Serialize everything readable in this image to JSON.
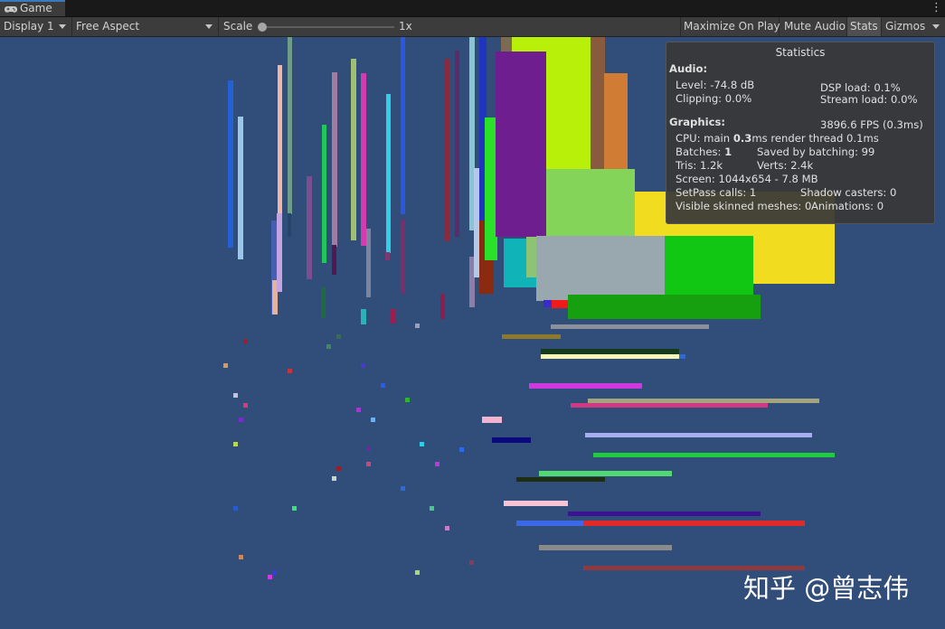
{
  "tab": {
    "title": "Game",
    "icon": "gamepad-icon"
  },
  "menu_icon": "kebab-menu-icon",
  "toolbar": {
    "display": "Display 1",
    "aspect": "Free Aspect",
    "scale_label": "Scale",
    "scale_value": "1x",
    "maximize": "Maximize On Play",
    "mute": "Mute Audio",
    "stats": "Stats",
    "gizmos": "Gizmos"
  },
  "stats": {
    "title": "Statistics",
    "audio_header": "Audio:",
    "level": "Level: -74.8 dB",
    "dsp": "DSP load: 0.1%",
    "clipping": "Clipping: 0.0%",
    "stream": "Stream load: 0.0%",
    "graphics_header": "Graphics:",
    "fps": "3896.6 FPS (0.3ms)",
    "cpu_prefix": "CPU: main ",
    "cpu_main": "0.3",
    "cpu_suffix": "ms  render thread 0.1ms",
    "batches_prefix": "Batches: ",
    "batches": "1",
    "saved": "Saved by batching: 99",
    "tris": "Tris: 1.2k",
    "verts": "Verts: 2.4k",
    "screen": "Screen: 1044x654 - 7.8 MB",
    "setpass": "SetPass calls: 1",
    "shadow": "Shadow casters: 0",
    "skinned": "Visible skinned meshes: 0",
    "animations": "Animations: 0"
  },
  "watermark": "知乎 @曾志伟"
}
